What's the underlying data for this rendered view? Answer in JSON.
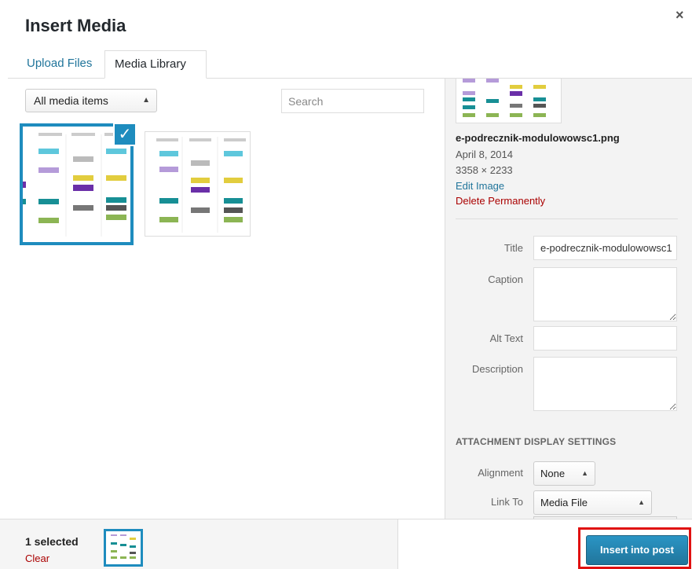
{
  "header": {
    "title": "Insert Media",
    "close_glyph": "×"
  },
  "tabs": [
    {
      "label": "Upload Files",
      "active": false
    },
    {
      "label": "Media Library",
      "active": true
    }
  ],
  "toolbar": {
    "filter_value": "All media items",
    "search_placeholder": "Search"
  },
  "attachments": [
    {
      "thumbnail": "e-podrecznik-modulowowsc1.png",
      "selected": true
    },
    {
      "thumbnail": "second diagram image",
      "selected": false
    }
  ],
  "details": {
    "filename": "e-podrecznik-modulowowsc1.png",
    "date": "April 8, 2014",
    "dimensions": "3358 × 2233",
    "edit_link": "Edit Image",
    "delete_link": "Delete Permanently",
    "fields": {
      "title_label": "Title",
      "title_value": "e-podrecznik-modulowowsc1",
      "caption_label": "Caption",
      "alt_label": "Alt Text",
      "description_label": "Description"
    }
  },
  "display_settings": {
    "heading": "ATTACHMENT DISPLAY SETTINGS",
    "alignment_label": "Alignment",
    "alignment_value": "None",
    "link_label": "Link To",
    "link_value": "Media File"
  },
  "footer": {
    "selected_count": "1 selected",
    "clear_label": "Clear",
    "insert_label": "Insert into post"
  },
  "colors": {
    "accent": "#1e8cbe",
    "link": "#21759b",
    "danger": "#a00000",
    "highlight_frame": "#e01010"
  }
}
